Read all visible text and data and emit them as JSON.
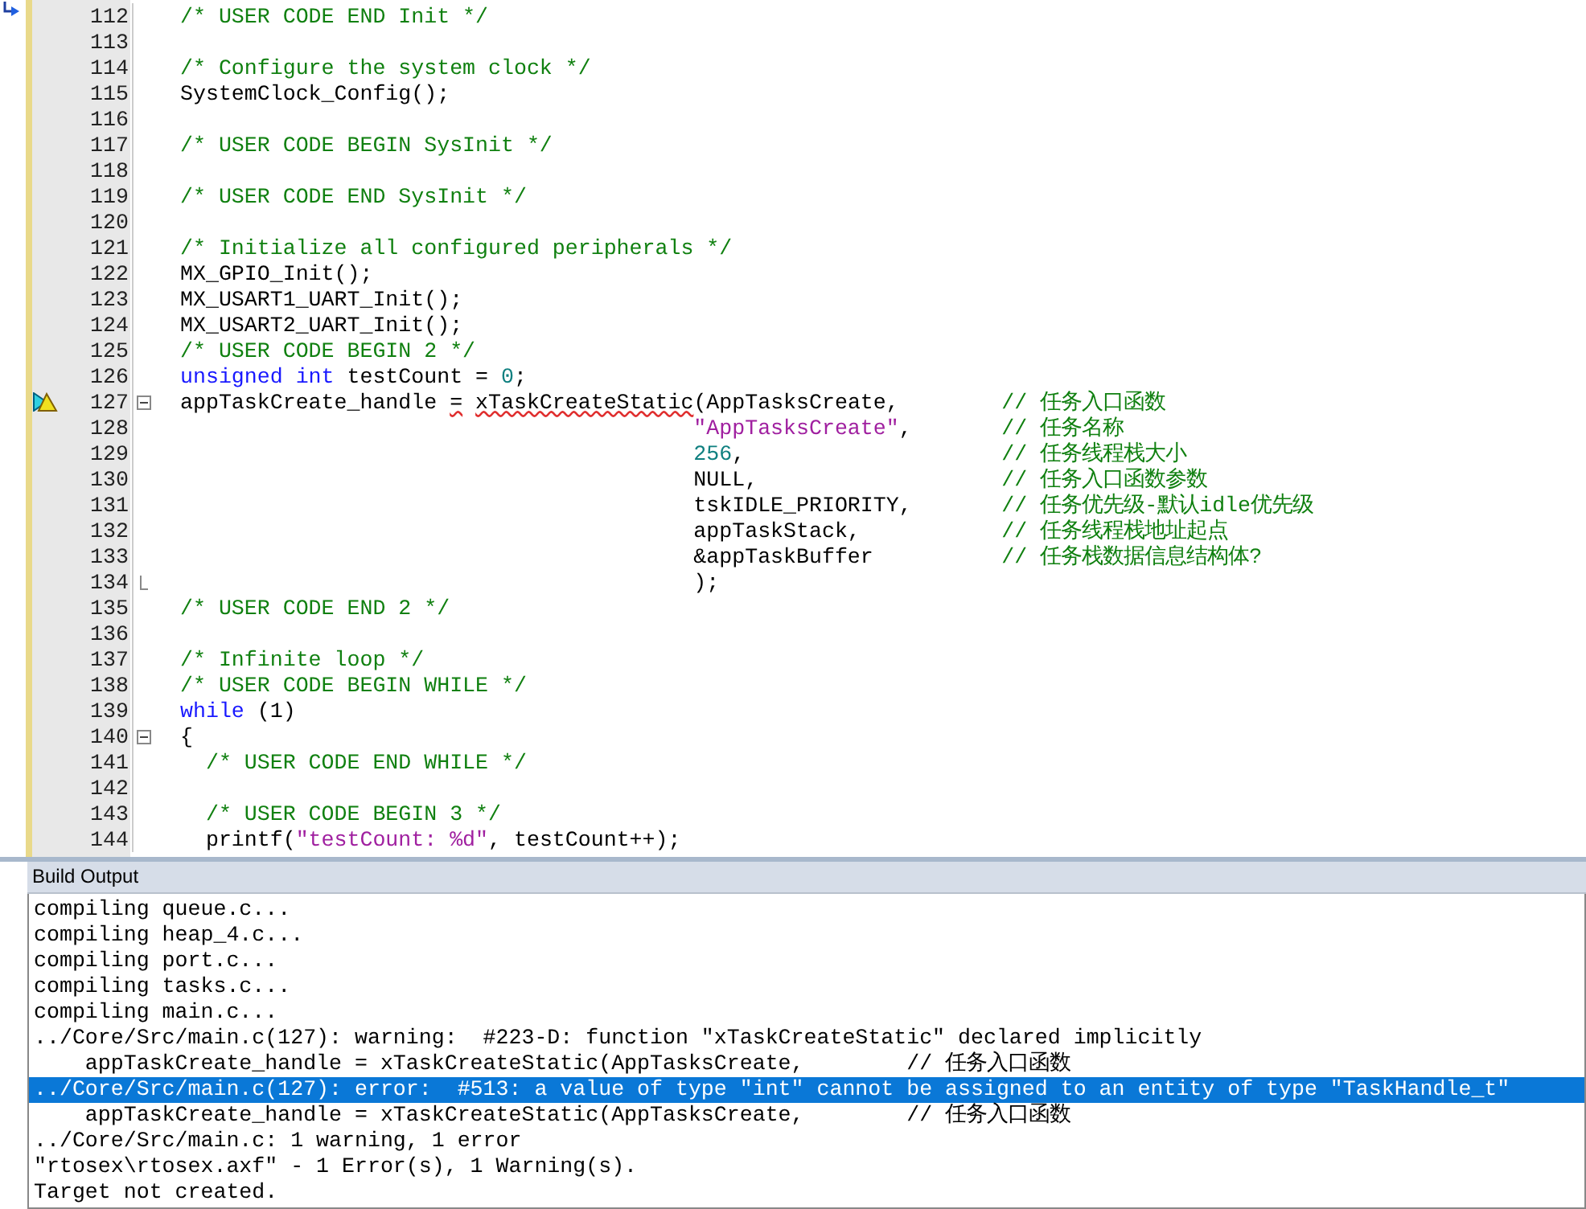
{
  "editor": {
    "lines": [
      {
        "num": "112",
        "warning": false,
        "fold_start": false,
        "fold_end": false,
        "tokens": [
          {
            "kind": "comment",
            "text": "/* USER CODE END Init */"
          }
        ]
      },
      {
        "num": "113",
        "warning": false,
        "fold_start": false,
        "fold_end": false
      },
      {
        "num": "114",
        "warning": false,
        "fold_start": false,
        "fold_end": false,
        "tokens": [
          {
            "kind": "comment",
            "text": "/* Configure the system clock */"
          }
        ]
      },
      {
        "num": "115",
        "warning": false,
        "fold_start": false,
        "fold_end": false,
        "tokens": [
          {
            "kind": "plain",
            "text": "SystemClock_Config();"
          }
        ]
      },
      {
        "num": "116",
        "warning": false,
        "fold_start": false,
        "fold_end": false
      },
      {
        "num": "117",
        "warning": false,
        "fold_start": false,
        "fold_end": false,
        "tokens": [
          {
            "kind": "comment",
            "text": "/* USER CODE BEGIN SysInit */"
          }
        ]
      },
      {
        "num": "118",
        "warning": false,
        "fold_start": false,
        "fold_end": false
      },
      {
        "num": "119",
        "warning": false,
        "fold_start": false,
        "fold_end": false,
        "tokens": [
          {
            "kind": "comment",
            "text": "/* USER CODE END SysInit */"
          }
        ]
      },
      {
        "num": "120",
        "warning": false,
        "fold_start": false,
        "fold_end": false
      },
      {
        "num": "121",
        "warning": false,
        "fold_start": false,
        "fold_end": false,
        "tokens": [
          {
            "kind": "comment",
            "text": "/* Initialize all configured peripherals */"
          }
        ]
      },
      {
        "num": "122",
        "warning": false,
        "fold_start": false,
        "fold_end": false,
        "tokens": [
          {
            "kind": "plain",
            "text": "MX_GPIO_Init();"
          }
        ]
      },
      {
        "num": "123",
        "warning": false,
        "fold_start": false,
        "fold_end": false,
        "tokens": [
          {
            "kind": "plain",
            "text": "MX_USART1_UART_Init();"
          }
        ]
      },
      {
        "num": "124",
        "warning": false,
        "fold_start": false,
        "fold_end": false,
        "tokens": [
          {
            "kind": "plain",
            "text": "MX_USART2_UART_Init();"
          }
        ]
      },
      {
        "num": "125",
        "warning": false,
        "fold_start": false,
        "fold_end": false,
        "tokens": [
          {
            "kind": "comment",
            "text": "/* USER CODE BEGIN 2 */"
          }
        ]
      },
      {
        "num": "126",
        "warning": false,
        "fold_start": false,
        "fold_end": false,
        "tokens": [
          {
            "kind": "keyword",
            "text": "unsigned"
          },
          {
            "kind": "keyword",
            "text": " int"
          },
          {
            "kind": "plain",
            "text": " testCount = "
          },
          {
            "kind": "number",
            "text": "0"
          },
          {
            "kind": "plain",
            "text": ";"
          }
        ]
      },
      {
        "num": "127",
        "warning": true,
        "fold_start": true,
        "fold_end": false,
        "tokens": [
          {
            "kind": "plain",
            "text": "appTaskCreate_handle "
          },
          {
            "kind": "error",
            "text": "="
          },
          {
            "kind": "error_spaced",
            "text": "xTaskCreateStatic"
          },
          {
            "kind": "plain",
            "text": "(AppTasksCreate,"
          }
        ],
        "comment": "// 任务入口函数"
      },
      {
        "num": "128",
        "warning": false,
        "fold_start": false,
        "fold_end": false,
        "argument": [
          {
            "kind": "string",
            "text": "\"AppTasksCreate\""
          },
          {
            "kind": "plain",
            "text": ","
          }
        ],
        "comment": "// 任务名称"
      },
      {
        "num": "129",
        "warning": false,
        "fold_start": false,
        "fold_end": false,
        "argument": [
          {
            "kind": "number",
            "text": "256"
          },
          {
            "kind": "plain",
            "text": ","
          }
        ],
        "comment": "// 任务线程栈大小"
      },
      {
        "num": "130",
        "warning": false,
        "fold_start": false,
        "fold_end": false,
        "argument": [
          {
            "kind": "plain",
            "text": "NULL,"
          }
        ],
        "comment": "// 任务入口函数参数"
      },
      {
        "num": "131",
        "warning": false,
        "fold_start": false,
        "fold_end": false,
        "argument": [
          {
            "kind": "plain",
            "text": "tskIDLE_PRIORITY,"
          }
        ],
        "comment": "// 任务优先级-默认idle优先级"
      },
      {
        "num": "132",
        "warning": false,
        "fold_start": false,
        "fold_end": false,
        "argument": [
          {
            "kind": "plain",
            "text": "appTaskStack,"
          }
        ],
        "comment": "// 任务线程栈地址起点"
      },
      {
        "num": "133",
        "warning": false,
        "fold_start": false,
        "fold_end": false,
        "argument": [
          {
            "kind": "plain",
            "text": "&appTaskBuffer"
          }
        ],
        "comment": "// 任务栈数据信息结构体?"
      },
      {
        "num": "134",
        "warning": false,
        "fold_start": false,
        "fold_end": true,
        "argument": [
          {
            "kind": "plain",
            "text": ");"
          }
        ]
      },
      {
        "num": "135",
        "warning": false,
        "fold_start": false,
        "fold_end": false,
        "tokens": [
          {
            "kind": "comment",
            "text": "/* USER CODE END 2 */"
          }
        ]
      },
      {
        "num": "136",
        "warning": false,
        "fold_start": false,
        "fold_end": false
      },
      {
        "num": "137",
        "warning": false,
        "fold_start": false,
        "fold_end": false,
        "tokens": [
          {
            "kind": "comment",
            "text": "/* Infinite loop */"
          }
        ]
      },
      {
        "num": "138",
        "warning": false,
        "fold_start": false,
        "fold_end": false,
        "tokens": [
          {
            "kind": "comment",
            "text": "/* USER CODE BEGIN WHILE */"
          }
        ]
      },
      {
        "num": "139",
        "warning": false,
        "fold_start": false,
        "fold_end": false,
        "tokens": [
          {
            "kind": "keyword",
            "text": "while"
          },
          {
            "kind": "plain",
            "text": " (1)"
          }
        ]
      },
      {
        "num": "140",
        "warning": false,
        "fold_start": true,
        "fold_end": false,
        "tokens": [
          {
            "kind": "plain",
            "text": "{"
          }
        ]
      },
      {
        "num": "141",
        "warning": false,
        "fold_start": false,
        "fold_end": false,
        "tokens": [
          {
            "kind": "comment",
            "text": "  /* USER CODE END WHILE */"
          }
        ]
      },
      {
        "num": "142",
        "warning": false,
        "fold_start": false,
        "fold_end": false
      },
      {
        "num": "143",
        "warning": false,
        "fold_start": false,
        "fold_end": false,
        "tokens": [
          {
            "kind": "comment",
            "text": "  /* USER CODE BEGIN 3 */"
          }
        ]
      },
      {
        "num": "144",
        "warning": false,
        "fold_start": false,
        "fold_end": false,
        "tokens": [
          {
            "kind": "plain",
            "text": "  printf("
          },
          {
            "kind": "string",
            "text": "\"testCount: %d\""
          },
          {
            "kind": "plain",
            "text": ", testCount++);"
          }
        ]
      }
    ]
  },
  "build_output": {
    "title": "Build Output",
    "lines": [
      {
        "text": "compiling queue.c...",
        "selected": false
      },
      {
        "text": "compiling heap_4.c...",
        "selected": false
      },
      {
        "text": "compiling port.c...",
        "selected": false
      },
      {
        "text": "compiling tasks.c...",
        "selected": false
      },
      {
        "text": "compiling main.c...",
        "selected": false
      },
      {
        "text": "../Core/Src/main.c(127): warning:  #223-D: function \"xTaskCreateStatic\" declared implicitly",
        "selected": false
      },
      {
        "text": "    appTaskCreate_handle = xTaskCreateStatic(AppTasksCreate,        // 任务入口函数",
        "selected": false
      },
      {
        "text": "../Core/Src/main.c(127): error:  #513: a value of type \"int\" cannot be assigned to an entity of type \"TaskHandle_t\"",
        "selected": true
      },
      {
        "text": "    appTaskCreate_handle = xTaskCreateStatic(AppTasksCreate,        // 任务入口函数",
        "selected": false
      },
      {
        "text": "../Core/Src/main.c: 1 warning, 1 error",
        "selected": false
      },
      {
        "text": "\"rtosex\\rtosex.axf\" - 1 Error(s), 1 Warning(s).",
        "selected": false
      },
      {
        "text": "Target not created.",
        "selected": false
      }
    ]
  }
}
